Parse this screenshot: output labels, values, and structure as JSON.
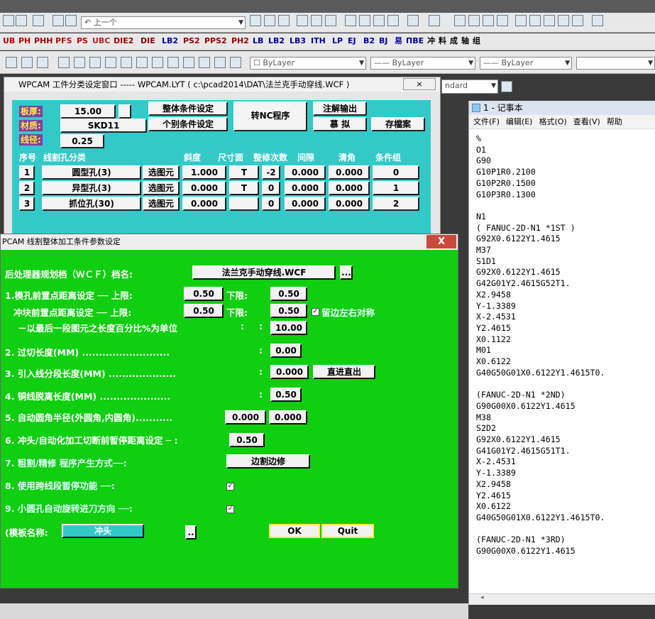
{
  "toolbar1": {
    "undo_label": "↶ 上一个"
  },
  "toolbar2": {
    "cad_items": [
      "UB",
      "PH",
      "PHH",
      "PFS",
      "PS",
      "UBC",
      "DIE2",
      "DIE",
      "LB2",
      "PS2",
      "PPS2",
      "PH2",
      "LB",
      "LB2",
      "LB3",
      "ITH",
      "LP",
      "EJ",
      "B2",
      "BJ",
      "易",
      "ПВЕ",
      "冲",
      "料",
      "成",
      "轴",
      "组"
    ]
  },
  "toolbar3": {
    "layer_combo": "☐ ByLayer",
    "linetype_combo": "—— ByLayer",
    "lineweight_combo": "—— ByLayer"
  },
  "standard_combo": "ndard",
  "win1": {
    "title": "WPCAM 工件分类设定窗口 ----- WPCAM.LYT ( c:\\pcad2014\\DAT\\法兰克手动穿线.WCF )",
    "plate_thickness_label": "板厚:",
    "plate_thickness_value": "15.00",
    "material_label": "材质:",
    "material_value": "SKD11",
    "wire_diameter_label": "线径:",
    "wire_diameter_value": "0.25",
    "global_settings_button": "整体条件设定",
    "individual_settings_button": "个别条件设定",
    "to_nc_button": "转NC程序",
    "annotation_output_button": "注解输出",
    "simulate_button": "慕 拟",
    "save_button": "存檔案",
    "columns": [
      "序号",
      "线割孔分类",
      "斜度",
      "尺寸面",
      "整修次数",
      "间隙",
      "清角",
      "条件组"
    ],
    "rows": [
      {
        "no": "1",
        "type": "圆型孔(3)",
        "select": "选图元",
        "taper": "1.000",
        "face": "T",
        "passes": "-2",
        "gap": "0.000",
        "corner": "0.000",
        "group": "0"
      },
      {
        "no": "2",
        "type": "异型孔(3)",
        "select": "选图元",
        "taper": "0.000",
        "face": "T",
        "passes": "0",
        "gap": "0.000",
        "corner": "0.000",
        "group": "1"
      },
      {
        "no": "3",
        "type": "抓位孔(30)",
        "select": "选图元",
        "taper": "0.000",
        "face": "",
        "passes": "0",
        "gap": "0.000",
        "corner": "0.000",
        "group": "2"
      }
    ]
  },
  "win2": {
    "title": "PCAM 线割整体加工条件参数设定",
    "close_label": "X",
    "post_processor_label": "后处理器规划档（ＷＣＦ）档名:",
    "post_processor_value": "法兰克手动穿线.WCF",
    "browse_label": "...",
    "die_approach_label": "1.模孔前置点距离设定 ── 上限:",
    "die_approach_upper": "0.50",
    "lower_label": "下限:",
    "die_approach_lower": "0.50",
    "punch_approach_label": "冲块前置点距离设定 ── 上限:",
    "punch_approach_upper": "0.50",
    "punch_approach_lower": "0.50",
    "symmetric_label": "留边左右对称",
    "percent_label": "－以最后一段图元之长度百分比%为单位",
    "colon": ":",
    "percent_value": "10.00",
    "overcut_label": "2. 过切长度(MM) ..........................",
    "overcut_value": "0.00",
    "leadin_label": "3. 引入线分段长度(MM) ....................",
    "leadin_value": "0.000",
    "direct_out_button": "直进直出",
    "wire_release_label": "4. 铜线脱离长度(MM) .....................",
    "wire_release_value": "0.50",
    "fillet_label": "5. 自动圆角半径(外圆角,内圆角)...........",
    "fillet_outer": "0.000",
    "fillet_inner": "0.000",
    "pause_label": "6. 冲头/自动化加工切断前暂停距离设定 ─ :",
    "pause_value": "0.50",
    "rough_finish_label": "7. 粗割/精修 程序产生方式──:",
    "rough_finish_value": "边割边修",
    "cross_pause_label": "8. 使用跨线段暂停功能   ──:",
    "small_hole_label": "9. 小圆孔自动旋转进刀方向 ──:",
    "template_label": "(模板名称:",
    "template_value": "冲头",
    "template_browse": "..",
    "ok_button": "OK",
    "quit_button": "Quit"
  },
  "notepad": {
    "title": "1 - 记事本",
    "menu": [
      "文件(F)",
      "编辑(E)",
      "格式(O)",
      "查看(V)",
      "帮助"
    ],
    "content": "%\nO1\nG90\nG10P1R0.2100\nG10P2R0.1500\nG10P3R0.1300\n\nN1\n( FANUC-2D-N1 *1ST )\nG92X0.6122Y1.4615\nM37\nS1D1\nG92X0.6122Y1.4615\nG42G01Y2.4615G52T1.\nX2.9458\nY-1.3389\nX-2.4531\nY2.4615\nX0.1122\nM01\nX0.6122\nG40G50G01X0.6122Y1.4615T0.\n\n(FANUC-2D-N1 *2ND)\nG90G00X0.6122Y1.4615\nM38\nS2D2\nG92X0.6122Y1.4615\nG41G01Y2.4615G51T1.\nX-2.4531\nY-1.3389\nX2.9458\nY2.4615\nX0.6122\nG40G50G01X0.6122Y1.4615T0.\n\n(FANUC-2D-N1 *3RD)\nG90G00X0.6122Y1.4615"
  },
  "colors": {
    "cyan_panel": "#33c9c9",
    "green_panel": "#10ce10",
    "label_purple": "#8040a0"
  }
}
